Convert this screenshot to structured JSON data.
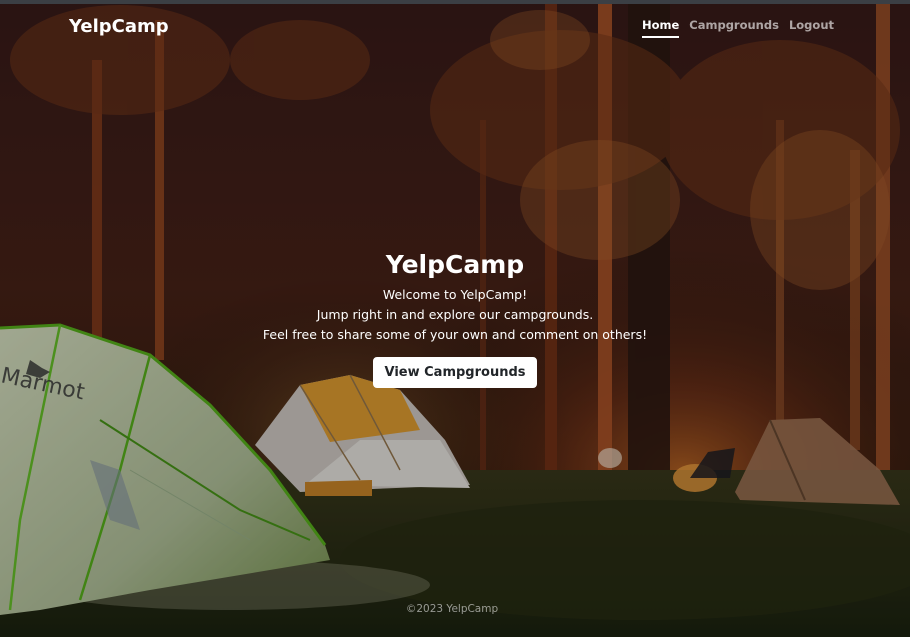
{
  "brand": "YelpCamp",
  "nav": {
    "home": "Home",
    "campgrounds": "Campgrounds",
    "logout": "Logout"
  },
  "hero": {
    "title": "YelpCamp",
    "line1": "Welcome to YelpCamp!",
    "line2": "Jump right in and explore our campgrounds.",
    "line3": "Feel free to share some of your own and comment on others!",
    "button_label": "View Campgrounds"
  },
  "background": {
    "tent_brand": "Marmot"
  },
  "footer": "©2023 YelpCamp"
}
